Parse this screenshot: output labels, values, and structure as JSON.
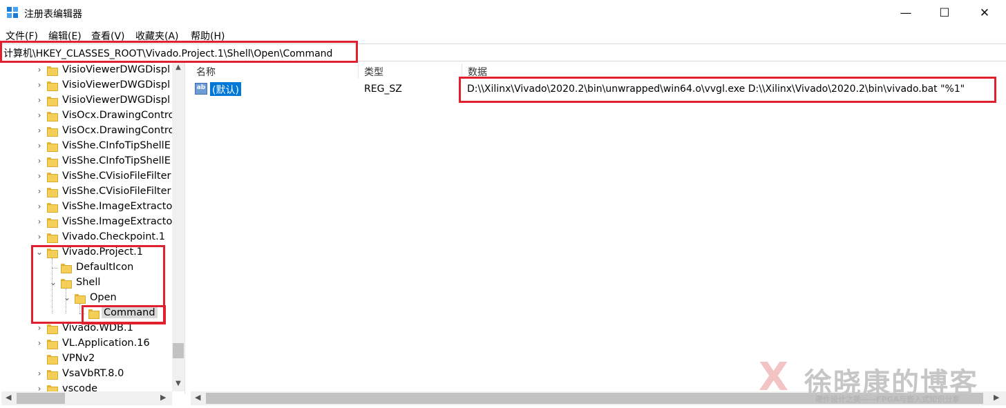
{
  "window": {
    "title": "注册表编辑器",
    "minimize_glyph": "—",
    "maximize_glyph": "☐",
    "close_glyph": "✕"
  },
  "menu": [
    "文件(F)",
    "编辑(E)",
    "查看(V)",
    "收藏夹(A)",
    "帮助(H)"
  ],
  "address": {
    "path": "计算机\\HKEY_CLASSES_ROOT\\Vivado.Project.1\\Shell\\Open\\Command"
  },
  "tree": {
    "items": [
      {
        "label": "VisioViewerDWGDispl",
        "expander": "›",
        "depth": 0
      },
      {
        "label": "VisioViewerDWGDispl",
        "expander": "›",
        "depth": 0
      },
      {
        "label": "VisioViewerDWGDispl",
        "expander": "›",
        "depth": 0
      },
      {
        "label": "VisOcx.DrawingContro",
        "expander": "›",
        "depth": 0
      },
      {
        "label": "VisOcx.DrawingContro",
        "expander": "›",
        "depth": 0
      },
      {
        "label": "VisShe.CInfoTipShellE",
        "expander": "›",
        "depth": 0
      },
      {
        "label": "VisShe.CInfoTipShellE",
        "expander": "›",
        "depth": 0
      },
      {
        "label": "VisShe.CVisioFileFilter",
        "expander": "›",
        "depth": 0
      },
      {
        "label": "VisShe.CVisioFileFilter",
        "expander": "›",
        "depth": 0
      },
      {
        "label": "VisShe.ImageExtracto",
        "expander": "›",
        "depth": 0
      },
      {
        "label": "VisShe.ImageExtracto",
        "expander": "›",
        "depth": 0
      },
      {
        "label": "Vivado.Checkpoint.1",
        "expander": "›",
        "depth": 0
      },
      {
        "label": "Vivado.Project.1",
        "expander": "⌄",
        "depth": 0
      },
      {
        "label": "DefaultIcon",
        "expander": "",
        "depth": 1
      },
      {
        "label": "Shell",
        "expander": "⌄",
        "depth": 1
      },
      {
        "label": "Open",
        "expander": "⌄",
        "depth": 2
      },
      {
        "label": "Command",
        "expander": "",
        "depth": 3,
        "selected": true
      },
      {
        "label": "Vivado.WDB.1",
        "expander": "›",
        "depth": 0
      },
      {
        "label": "VL.Application.16",
        "expander": "›",
        "depth": 0
      },
      {
        "label": "VPNv2",
        "expander": "",
        "depth": 0
      },
      {
        "label": "VsaVbRT.8.0",
        "expander": "›",
        "depth": 0
      },
      {
        "label": "vscode",
        "expander": "›",
        "depth": 0
      }
    ]
  },
  "list": {
    "columns": [
      "名称",
      "类型",
      "数据"
    ],
    "rows": [
      {
        "icon": "ab",
        "name": "(默认)",
        "type": "REG_SZ",
        "data": "D:\\\\Xilinx\\Vivado\\2020.2\\bin\\unwrapped\\win64.o\\vvgl.exe D:\\\\Xilinx\\Vivado\\2020.2\\bin\\vivado.bat \"%1\""
      }
    ]
  },
  "watermark": {
    "mark": "X",
    "title": "徐晓康的博客",
    "subtitle": "硬件设计之美——FPGA与嵌入式知识分享"
  },
  "colors": {
    "selection": "#0078d7",
    "annotation_red": "#e0202e",
    "folder_yellow": "#f3cf5a"
  }
}
